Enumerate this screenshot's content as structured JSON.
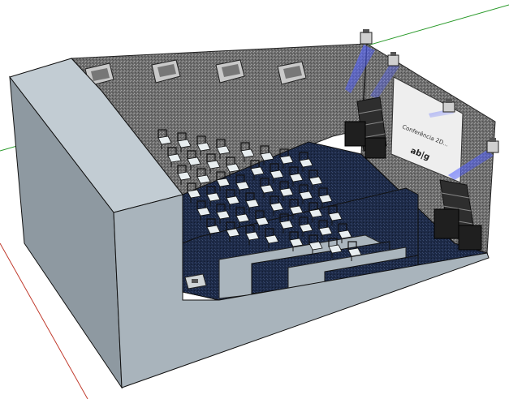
{
  "scene": {
    "screen_text": {
      "line1": "Conferência 2D...",
      "line2": "ab|g"
    },
    "colors": {
      "background": "#ffffff",
      "axis_green": "#2a9a2a",
      "axis_red": "#c0392b",
      "outer_wall_front": "#a9b4bc",
      "outer_wall_side": "#8e99a1",
      "outer_wall_top": "#c2ccd3",
      "interior_wall": "#6e6e6e",
      "carpet": "#1e2a45",
      "step_face": "#aab5bd",
      "screen": "#eeeeee",
      "speaker": "#2e2e2e",
      "chair": "#e8eef0",
      "spot_beam": "#4a5dff"
    },
    "icons": {
      "moving_head_light": "moving-head-light-icon",
      "line_array_speaker": "line-array-speaker-icon",
      "wall_fixture": "wall-fixture-icon",
      "chair": "chair-icon"
    }
  }
}
